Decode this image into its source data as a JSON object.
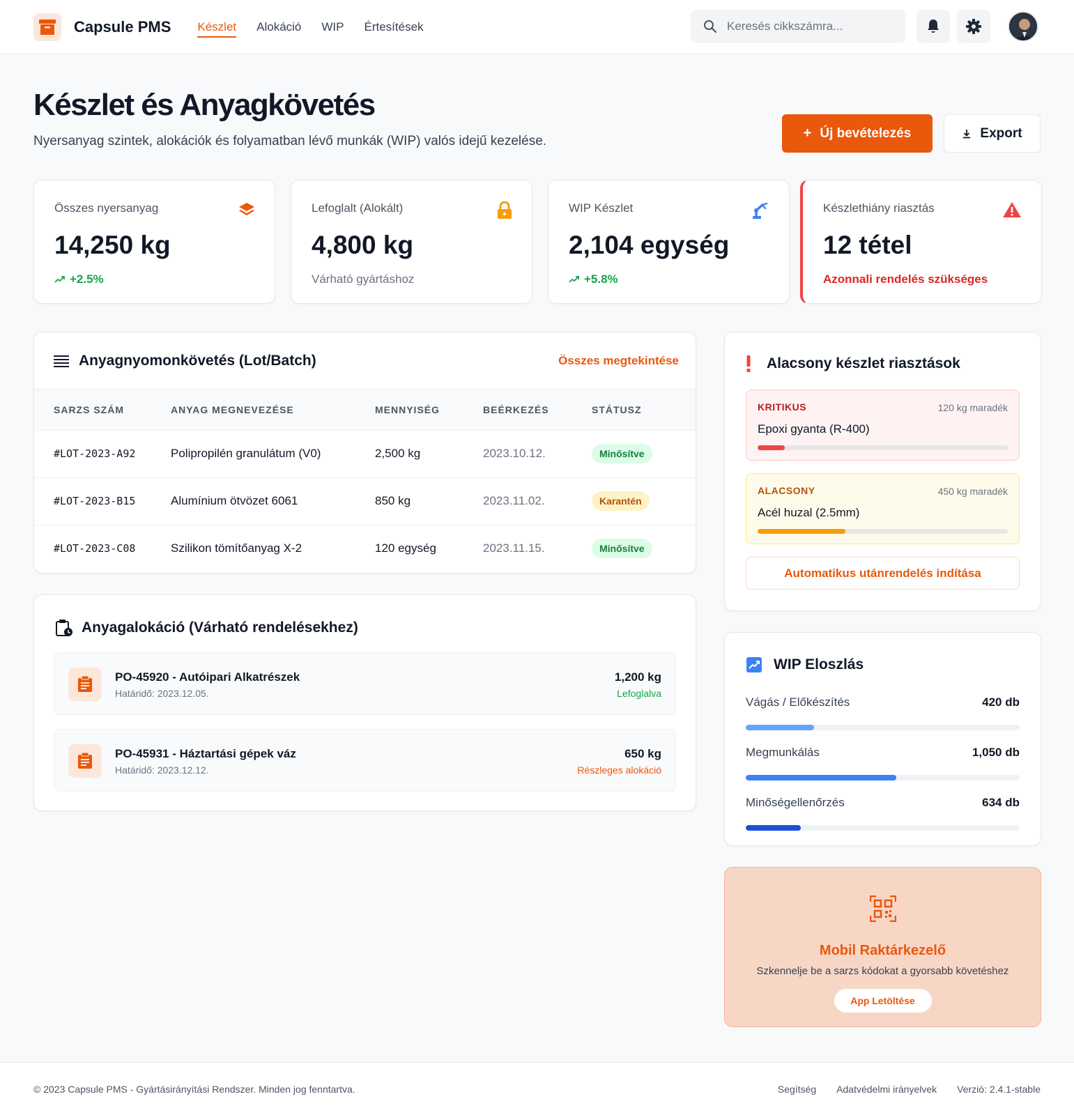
{
  "header": {
    "app_name": "Capsule PMS",
    "nav": [
      "Készlet",
      "Alokáció",
      "WIP",
      "Értesítések"
    ],
    "search_placeholder": "Keresés cikkszámra..."
  },
  "page": {
    "title": "Készlet és Anyagkövetés",
    "subtitle": "Nyersanyag szintek, alokációk és folyamatban lévő munkák (WIP) valós idejű kezelése.",
    "primary_btn": "Új bevételezés",
    "secondary_btn": "Export"
  },
  "stats": [
    {
      "label": "Összes nyersanyag",
      "value": "14,250 kg",
      "foot": "+2.5%"
    },
    {
      "label": "Lefoglalt (Alokált)",
      "value": "4,800 kg",
      "foot": "Várható gyártáshoz"
    },
    {
      "label": "WIP Készlet",
      "value": "2,104 egység",
      "foot": "+5.8%"
    },
    {
      "label": "Készlethiány riasztás",
      "value": "12 tétel",
      "foot": "Azonnali rendelés szükséges"
    }
  ],
  "lots": {
    "title": "Anyagnyomonkövetés (Lot/Batch)",
    "view_all": "Összes megtekintése",
    "columns": [
      "SARZS SZÁM",
      "ANYAG MEGNEVEZÉSE",
      "MENNYISÉG",
      "BEÉRKEZÉS",
      "STÁTUSZ"
    ],
    "rows": [
      {
        "lot": "#LOT-2023-A92",
        "name": "Polipropilén granulátum (V0)",
        "qty": "2,500 kg",
        "date": "2023.10.12.",
        "status": "Minősítve"
      },
      {
        "lot": "#LOT-2023-B15",
        "name": "Alumínium ötvözet 6061",
        "qty": "850 kg",
        "date": "2023.11.02.",
        "status": "Karantén"
      },
      {
        "lot": "#LOT-2023-C08",
        "name": "Szilikon tömítőanyag X-2",
        "qty": "120 egység",
        "date": "2023.11.15.",
        "status": "Minősítve"
      }
    ]
  },
  "allocation": {
    "title": "Anyagalokáció (Várható rendelésekhez)",
    "items": [
      {
        "title": "PO-45920 - Autóipari Alkatrészek",
        "deadline": "Határidő: 2023.12.05.",
        "qty": "1,200 kg",
        "status": "Lefoglalva"
      },
      {
        "title": "PO-45931 - Háztartási gépek váz",
        "deadline": "Határidő: 2023.12.12.",
        "qty": "650 kg",
        "status": "Részleges alokáció"
      }
    ]
  },
  "alerts": {
    "title": "Alacsony készlet riasztások",
    "items": [
      {
        "level": "KRITIKUS",
        "remaining": "120 kg maradék",
        "name": "Epoxi gyanta (R-400)",
        "fill": 0.11
      },
      {
        "level": "ALACSONY",
        "remaining": "450 kg maradék",
        "name": "Acél huzal (2.5mm)",
        "fill": 0.35
      }
    ],
    "button": "Automatikus utánrendelés indítása"
  },
  "wip": {
    "title": "WIP Eloszlás",
    "rows": [
      {
        "label": "Vágás / Előkészítés",
        "value": "420 db",
        "fill": 0.25
      },
      {
        "label": "Megmunkálás",
        "value": "1,050 db",
        "fill": 0.55
      },
      {
        "label": "Minőségellenőrzés",
        "value": "634 db",
        "fill": 0.2
      }
    ]
  },
  "promo": {
    "title": "Mobil Raktárkezelő",
    "subtitle": "Szkennelje be a sarzs kódokat a gyorsabb követéshez",
    "button": "App Letöltése"
  },
  "footer": {
    "copyright": "© 2023 Capsule PMS - Gyártásirányítási Rendszer. Minden jog fenntartva.",
    "links": [
      "Segítség",
      "Adatvédelmi irányelvek",
      "Verzió: 2.4.1-stable"
    ]
  },
  "colors": {
    "accent": "#ea580c",
    "success": "#16a34a",
    "danger": "#dc2626",
    "warning": "#f59e0b",
    "info": "#3b82f6"
  }
}
